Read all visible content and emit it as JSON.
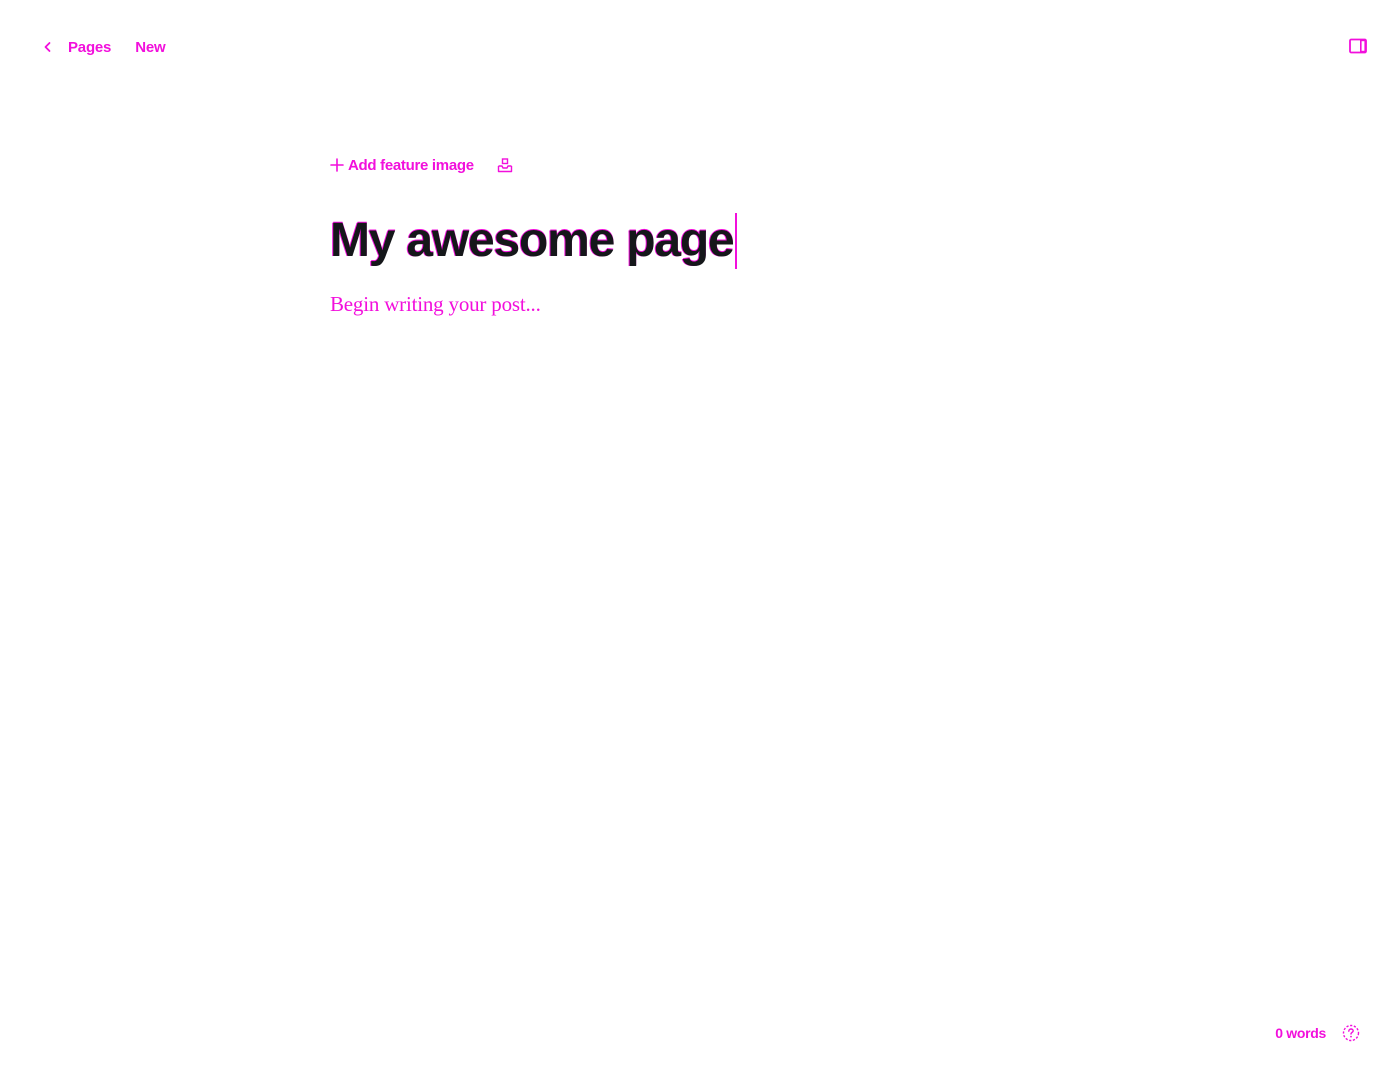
{
  "colors": {
    "accent": "#f20fdc",
    "title_text": "#15171a",
    "background": "#ffffff"
  },
  "breadcrumb": {
    "back_icon": "chevron-left-icon",
    "parent_label": "Pages",
    "status_label": "New"
  },
  "header": {
    "sidebar_toggle_icon": "sidebar-icon"
  },
  "editor": {
    "add_feature_image_label": "Add feature image",
    "add_feature_image_icon": "plus-icon",
    "upload_icon": "upload-icon",
    "title": "My awesome page",
    "body_placeholder": "Begin writing your post..."
  },
  "footer": {
    "word_count": "0 words",
    "help_icon": "help-circle-icon"
  }
}
